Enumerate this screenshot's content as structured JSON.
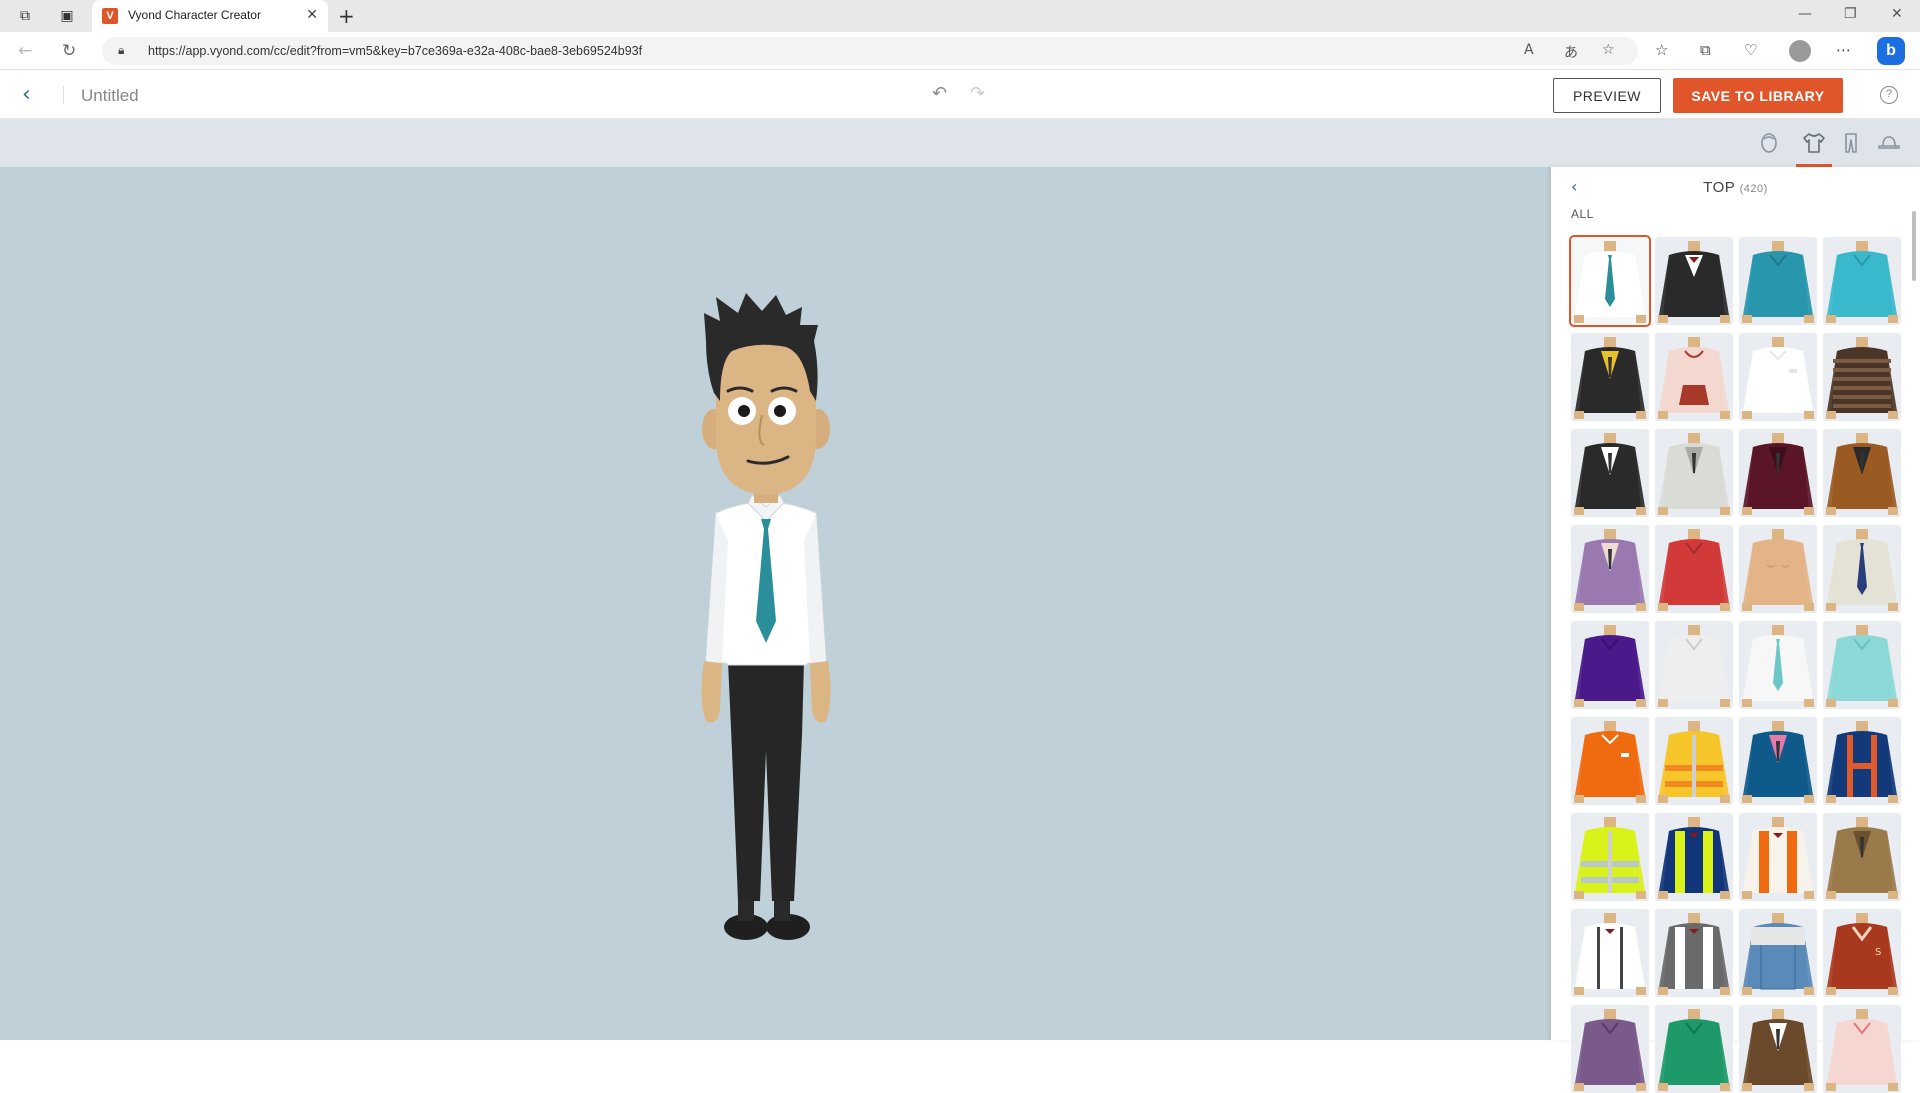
{
  "browser": {
    "tab_title": "Vyond Character Creator",
    "favicon_letter": "V",
    "url": "https://app.vyond.com/cc/edit?from=vm5&key=b7ce369a-e32a-408c-bae8-3eb69524b93f",
    "bing_letter": "b"
  },
  "header": {
    "doc_title": "Untitled",
    "preview_label": "PREVIEW",
    "save_label": "SAVE TO LIBRARY",
    "help_glyph": "?"
  },
  "panel": {
    "title": "TOP",
    "count": "(420)",
    "subtitle": "ALL",
    "items": [
      {
        "name": "white-shirt-teal-tie",
        "body": "#ffffff",
        "accent": "#2b8f9b",
        "type": "tie"
      },
      {
        "name": "black-tux-bowtie",
        "body": "#2a2a2a",
        "accent": "#ffffff",
        "type": "tux"
      },
      {
        "name": "teal-tshirt",
        "body": "#2896ad",
        "accent": "#1f7a8c",
        "type": "tee"
      },
      {
        "name": "light-teal-polo",
        "body": "#3ab9cc",
        "accent": "#2a97a8",
        "type": "polo"
      },
      {
        "name": "black-suit-yellow-tie",
        "body": "#2a2a2a",
        "accent": "#e8c12a",
        "type": "suit"
      },
      {
        "name": "pink-hoodie",
        "body": "#f3d8d0",
        "accent": "#a83a2a",
        "type": "hoodie"
      },
      {
        "name": "white-dress-shirt",
        "body": "#ffffff",
        "accent": "#e6e6e6",
        "type": "shirt"
      },
      {
        "name": "brown-striped-sweater",
        "body": "#4b3527",
        "accent": "#7b5b43",
        "type": "stripe"
      },
      {
        "name": "black-blazer",
        "body": "#2a2a2a",
        "accent": "#ffffff",
        "type": "suit"
      },
      {
        "name": "grey-blazer",
        "body": "#d8dbd6",
        "accent": "#a8aba6",
        "type": "suit"
      },
      {
        "name": "maroon-blazer",
        "body": "#5a1628",
        "accent": "#3d0e1b",
        "type": "suit"
      },
      {
        "name": "brown-suit",
        "body": "#9a5a22",
        "accent": "#2a2a2a",
        "type": "suit"
      },
      {
        "name": "purple-cardigan",
        "body": "#9a78b0",
        "accent": "#eedcd4",
        "type": "suit"
      },
      {
        "name": "red-blouse",
        "body": "#d23a3a",
        "accent": "#a82a2a",
        "type": "tee"
      },
      {
        "name": "bare-chest",
        "body": "#e2b488",
        "accent": "#d09c70",
        "type": "bare"
      },
      {
        "name": "khaki-uniform",
        "body": "#e4e2d4",
        "accent": "#2a3f7a",
        "type": "tie"
      },
      {
        "name": "purple-polo",
        "body": "#4a1a8a",
        "accent": "#3a1070",
        "type": "polo"
      },
      {
        "name": "white-scrubs-badge",
        "body": "#eeeeee",
        "accent": "#cccccc",
        "type": "tee"
      },
      {
        "name": "white-coat-teal",
        "body": "#f7f7f7",
        "accent": "#6cc7c9",
        "type": "tie"
      },
      {
        "name": "mint-scrubs",
        "body": "#8ad9d6",
        "accent": "#6cc1be",
        "type": "tee"
      },
      {
        "name": "orange-jacket",
        "body": "#f06a10",
        "accent": "#ffffff",
        "type": "shirt"
      },
      {
        "name": "yellow-hivis-jacket",
        "body": "#f5c52a",
        "accent": "#f08a20",
        "type": "hivis"
      },
      {
        "name": "blue-blazer-pink",
        "body": "#0e5a8a",
        "accent": "#e87aa8",
        "type": "suit"
      },
      {
        "name": "navy-harness",
        "body": "#123a7a",
        "accent": "#e05a2a",
        "type": "harness"
      },
      {
        "name": "lime-hivis",
        "body": "#d9f21a",
        "accent": "#b8c8c8",
        "type": "hivis"
      },
      {
        "name": "navy-hivis-vest",
        "body": "#12357a",
        "accent": "#d9f21a",
        "type": "vest"
      },
      {
        "name": "orange-safety-vest",
        "body": "#f7f2ea",
        "accent": "#f06a10",
        "type": "vest"
      },
      {
        "name": "brown-trench-coat",
        "body": "#9a7a4a",
        "accent": "#6a5230",
        "type": "suit"
      },
      {
        "name": "suspenders-bowtie",
        "body": "#ffffff",
        "accent": "#444444",
        "type": "suspender"
      },
      {
        "name": "grey-vest-bowtie",
        "body": "#6a6a6a",
        "accent": "#ffffff",
        "type": "vest"
      },
      {
        "name": "denim-overalls",
        "body": "#5a8ab8",
        "accent": "#e6e6e6",
        "type": "overall"
      },
      {
        "name": "varsity-jacket",
        "body": "#a8391f",
        "accent": "#f0d6b4",
        "type": "varsity"
      },
      {
        "name": "purple-top-partial",
        "body": "#7a5a8a",
        "accent": "#5a3a6a",
        "type": "tee"
      },
      {
        "name": "green-top-partial",
        "body": "#1e9a6a",
        "accent": "#0e7a4e",
        "type": "tee"
      },
      {
        "name": "brown-top-partial",
        "body": "#6a4a2a",
        "accent": "#ffffff",
        "type": "suit"
      },
      {
        "name": "pink-top-partial",
        "body": "#f5d6d0",
        "accent": "#e07a7a",
        "type": "tee"
      }
    ]
  },
  "icons": {
    "back": "back-chevron-icon",
    "undo": "undo-icon",
    "redo": "redo-icon",
    "categories": [
      "head-icon",
      "top-icon",
      "bottom-icon",
      "hat-icon"
    ]
  }
}
